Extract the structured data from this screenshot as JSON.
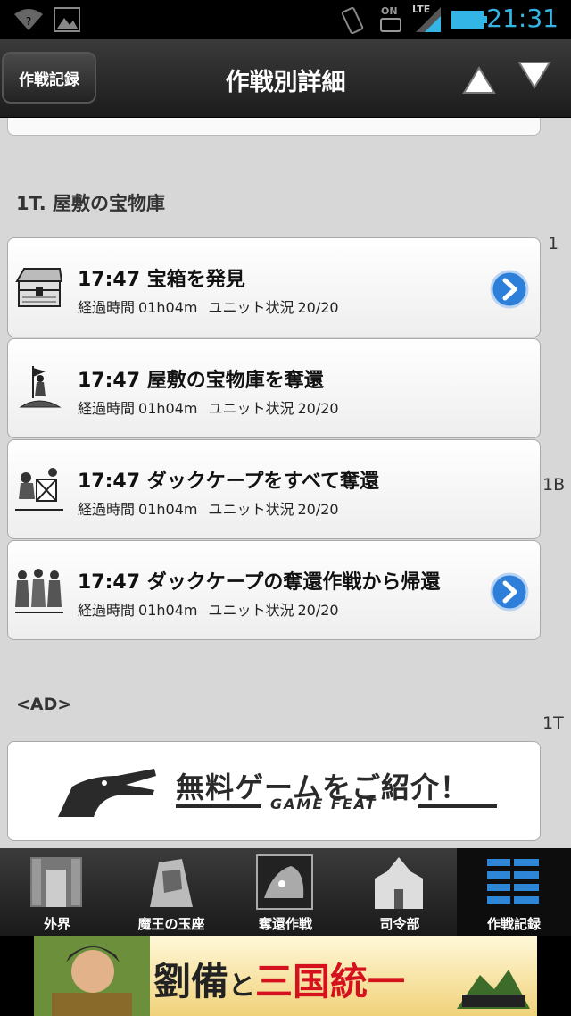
{
  "status_bar": {
    "time": "21:31",
    "icons": [
      "wifi-icon",
      "image-icon",
      "vibrate-icon",
      "on-icon",
      "lte-signal-icon",
      "battery-icon"
    ],
    "lte_label": "LTE",
    "on_label": "ON"
  },
  "header": {
    "back_label": "作戦記録",
    "title": "作戦別詳細"
  },
  "content": {
    "section_title": "1T. 屋敷の宝物庫",
    "side_notes": [
      "1",
      "1B",
      "1T"
    ],
    "elapsed_label": "経過時間",
    "unit_label": "ユニット状況",
    "events": [
      {
        "title": "17:47 宝箱を発見",
        "elapsed": "01h04m",
        "units": "20/20",
        "has_link": true,
        "icon": "treasure-chest-icon"
      },
      {
        "title": "17:47 屋敷の宝物庫を奪還",
        "elapsed": "01h04m",
        "units": "20/20",
        "has_link": false,
        "icon": "flag-hero-icon"
      },
      {
        "title": "17:47 ダックケープをすべて奪還",
        "elapsed": "01h04m",
        "units": "20/20",
        "has_link": false,
        "icon": "battle-scene-icon"
      },
      {
        "title": "17:47 ダックケープの奪還作戦から帰還",
        "elapsed": "01h04m",
        "units": "20/20",
        "has_link": true,
        "icon": "army-return-icon"
      }
    ],
    "ad_label": "<AD>",
    "ad_banner": {
      "text": "無料ゲームをご紹介！",
      "sub": "GAME FEAT"
    }
  },
  "tabbar": {
    "tabs": [
      {
        "label": "外界",
        "active": false
      },
      {
        "label": "魔王の玉座",
        "active": false
      },
      {
        "label": "奪還作戦",
        "active": false
      },
      {
        "label": "司令部",
        "active": false
      },
      {
        "label": "作戦記録",
        "active": true
      }
    ]
  },
  "bottom_ad": {
    "part1": "劉備",
    "part2": "と",
    "part3": "三国統一"
  }
}
